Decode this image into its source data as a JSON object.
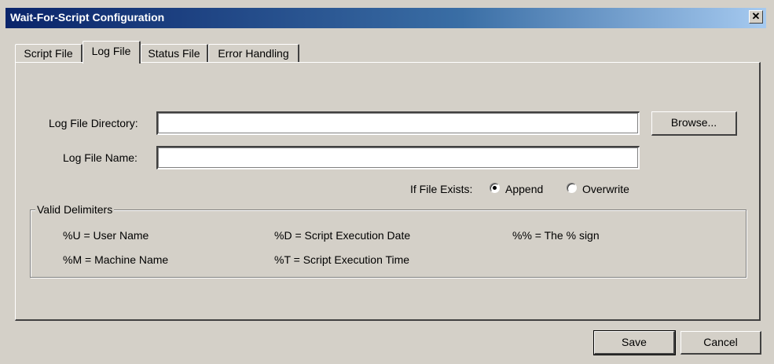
{
  "window": {
    "title": "Wait-For-Script Configuration",
    "close_glyph": "✕",
    "background_color": "#d4d0c8",
    "titlebar_color": "#0a246a"
  },
  "tabs": [
    {
      "label": "Script File",
      "active": false
    },
    {
      "label": "Log File",
      "active": true
    },
    {
      "label": "Status File",
      "active": false
    },
    {
      "label": "Error Handling",
      "active": false
    }
  ],
  "log_file": {
    "directory_label": "Log File Directory:",
    "directory_value": "",
    "name_label": "Log File Name:",
    "name_value": "",
    "browse_label": "Browse...",
    "if_exists_label": "If File Exists:",
    "options": [
      {
        "label": "Append",
        "selected": true
      },
      {
        "label": "Overwrite",
        "selected": false
      }
    ]
  },
  "delimiters": {
    "title": "Valid Delimiters",
    "items": [
      "%U = User Name",
      "%D = Script Execution Date",
      "%% = The % sign",
      "%M = Machine Name",
      "%T = Script Execution Time"
    ]
  },
  "footer": {
    "save_label": "Save",
    "cancel_label": "Cancel"
  }
}
